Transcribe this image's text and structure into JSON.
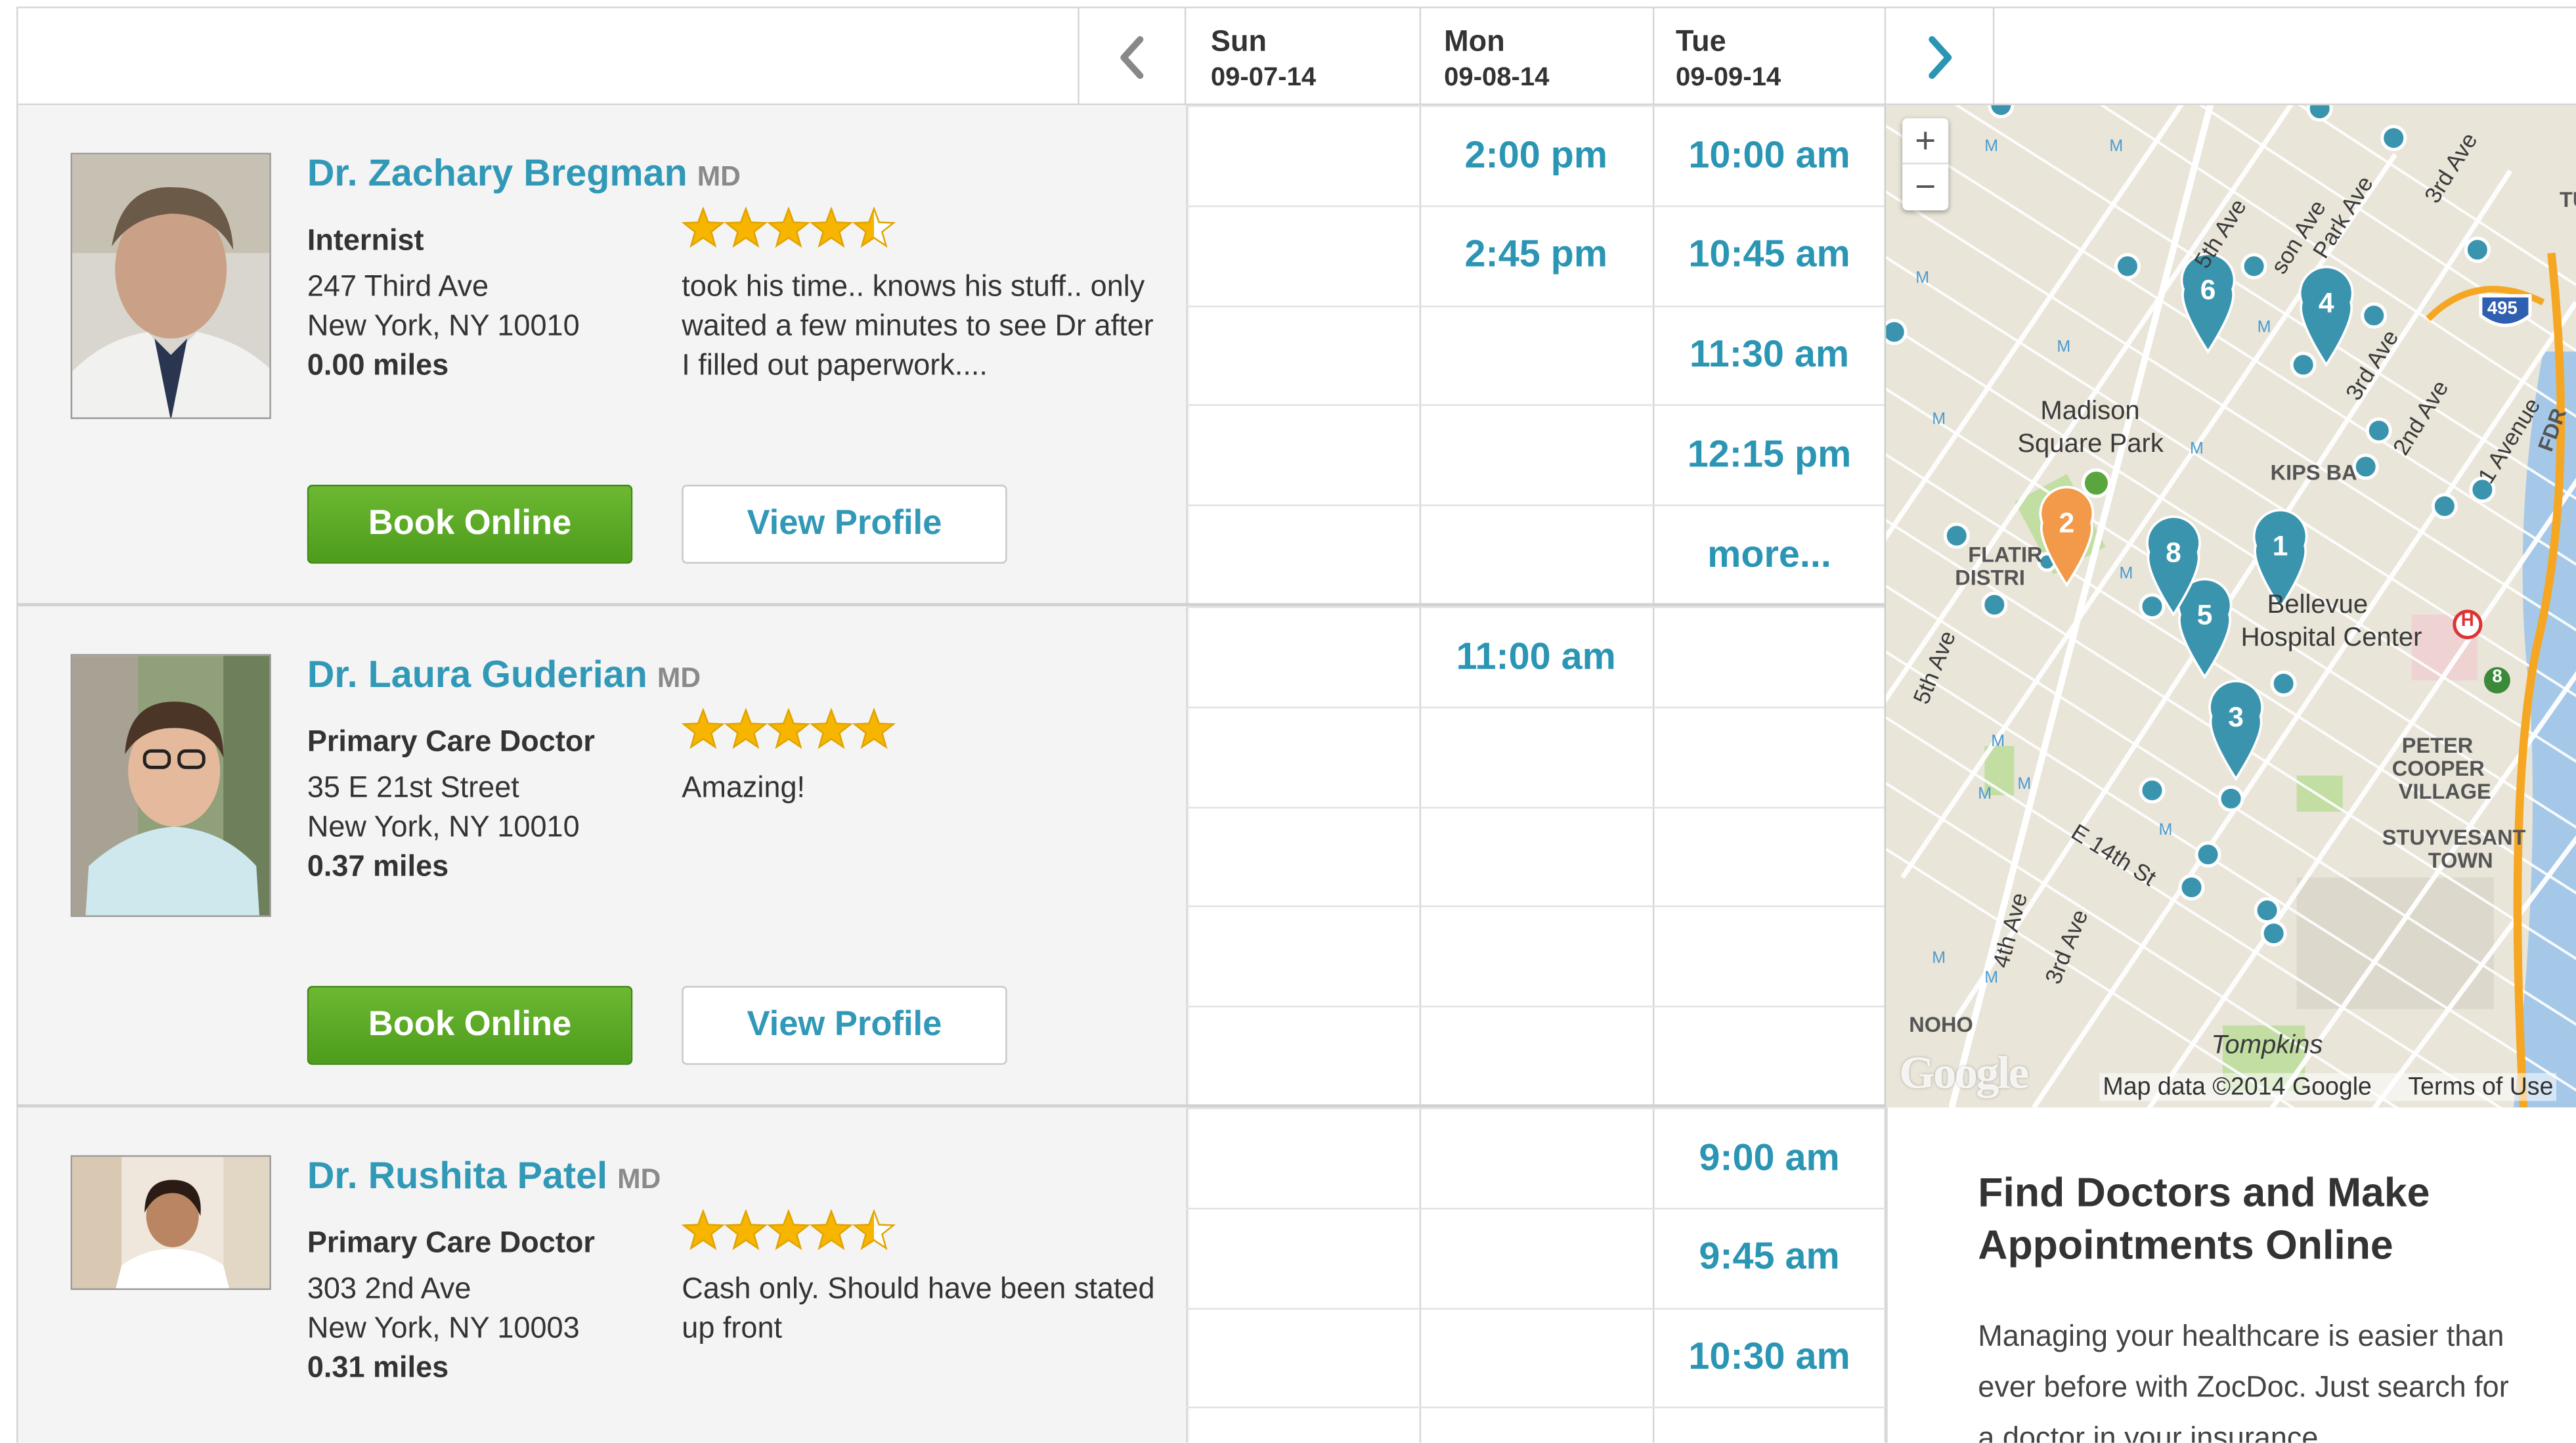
{
  "nav": {
    "prev_icon": "chevron-left-icon",
    "next_icon": "chevron-right-icon"
  },
  "days": [
    {
      "name": "Sun",
      "date": "09-07-14"
    },
    {
      "name": "Mon",
      "date": "09-08-14"
    },
    {
      "name": "Tue",
      "date": "09-09-14"
    }
  ],
  "doctors": [
    {
      "name": "Dr. Zachary Bregman",
      "credential": "MD",
      "specialty": "Internist",
      "address1": "247 Third Ave",
      "address2": "New York, NY 10010",
      "distance": "0.00 miles",
      "rating": 4.5,
      "review": "took his time.. knows his stuff.. only waited a few minutes to see Dr after I filled out paperwork....",
      "book_label": "Book Online",
      "profile_label": "View Profile",
      "slots": {
        "sun": [],
        "mon": [
          "2:00 pm",
          "2:45 pm"
        ],
        "tue": [
          "10:00 am",
          "10:45 am",
          "11:30 am",
          "12:15 pm",
          "more..."
        ]
      }
    },
    {
      "name": "Dr. Laura Guderian",
      "credential": "MD",
      "specialty": "Primary Care Doctor",
      "address1": "35 E 21st Street",
      "address2": "New York, NY 10010",
      "distance": "0.37 miles",
      "rating": 5,
      "review": "Amazing!",
      "book_label": "Book Online",
      "profile_label": "View Profile",
      "slots": {
        "sun": [],
        "mon": [
          "11:00 am"
        ],
        "tue": []
      }
    },
    {
      "name": "Dr. Rushita Patel",
      "credential": "MD",
      "specialty": "Primary Care Doctor",
      "address1": "303 2nd Ave",
      "address2": "New York, NY 10003",
      "distance": "0.31 miles",
      "rating": 4.5,
      "review": "Cash only. Should have been stated up front",
      "slots": {
        "sun": [],
        "mon": [],
        "tue": [
          "9:00 am",
          "9:45 am",
          "10:30 am"
        ]
      }
    }
  ],
  "map": {
    "zoom_in": "+",
    "zoom_out": "−",
    "labels": {
      "madison1": "Madison",
      "madison2": "Square Park",
      "bellevue1": "Bellevue",
      "bellevue2": "Hospital Center",
      "kips": "KIPS BA",
      "flatiron1": "FLATIR",
      "flatiron2": "DISTRI",
      "peter1": "PETER",
      "peter2": "COOPER",
      "peter3": "VILLAGE",
      "stuy1": "STUYVESANT",
      "stuy2": "TOWN",
      "noho": "NOHO",
      "tompkins": "Tompkins",
      "fifth": "5th Ave",
      "fifth2": "5th Ave",
      "lex": "son Ave",
      "park": "Park Ave",
      "third": "3rd Ave",
      "third2": "3rd Ave",
      "third3": "3rd Ave",
      "second": "2nd Ave",
      "first": "1 Avenue",
      "fourth": "4th Ave",
      "e14": "E 14th St",
      "tu": "TU",
      "fdr": "FDR",
      "hwy": "495",
      "h": "H",
      "eight": "8"
    },
    "pins": [
      "1",
      "2",
      "3",
      "4",
      "5",
      "6",
      "8"
    ],
    "footer_data": "Map data ©2014 Google",
    "footer_terms": "Terms of Use",
    "logo": "Google"
  },
  "info": {
    "title": "Find Doctors and Make Appointments Online",
    "body": "Managing your healthcare is easier than ever before with ZocDoc. Just search for a doctor in your insurance"
  },
  "colors": {
    "accent": "#3199b7",
    "book_green": "#5aa924",
    "star": "#f7b500",
    "pin_teal": "#3a94ad",
    "pin_orange": "#f2994a"
  }
}
